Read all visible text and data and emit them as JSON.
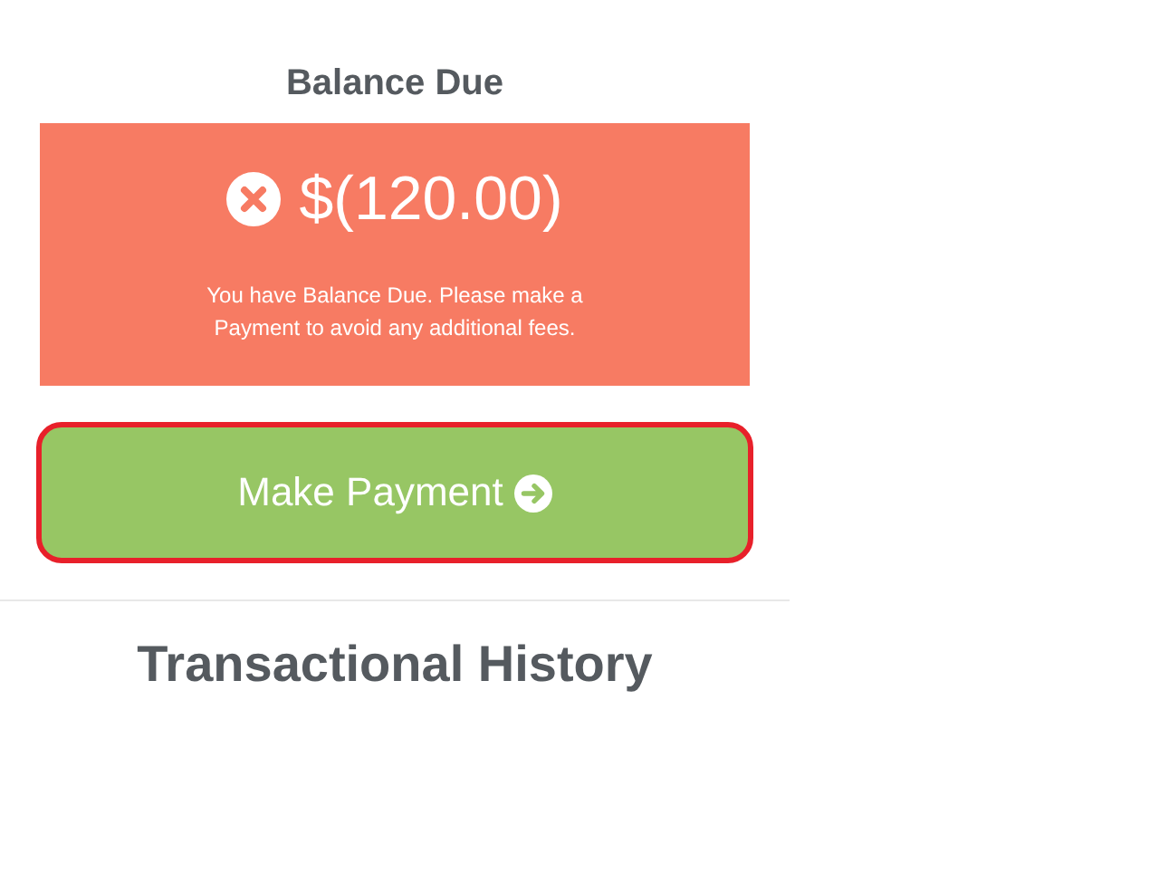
{
  "balance": {
    "title": "Balance Due",
    "overdue": true,
    "amount": "$(120.00)",
    "message": "You have Balance Due. Please make a Payment to avoid any additional fees."
  },
  "payment_button": {
    "label": "Make Payment",
    "highlighted": true
  },
  "history": {
    "title": "Transactional History"
  }
}
